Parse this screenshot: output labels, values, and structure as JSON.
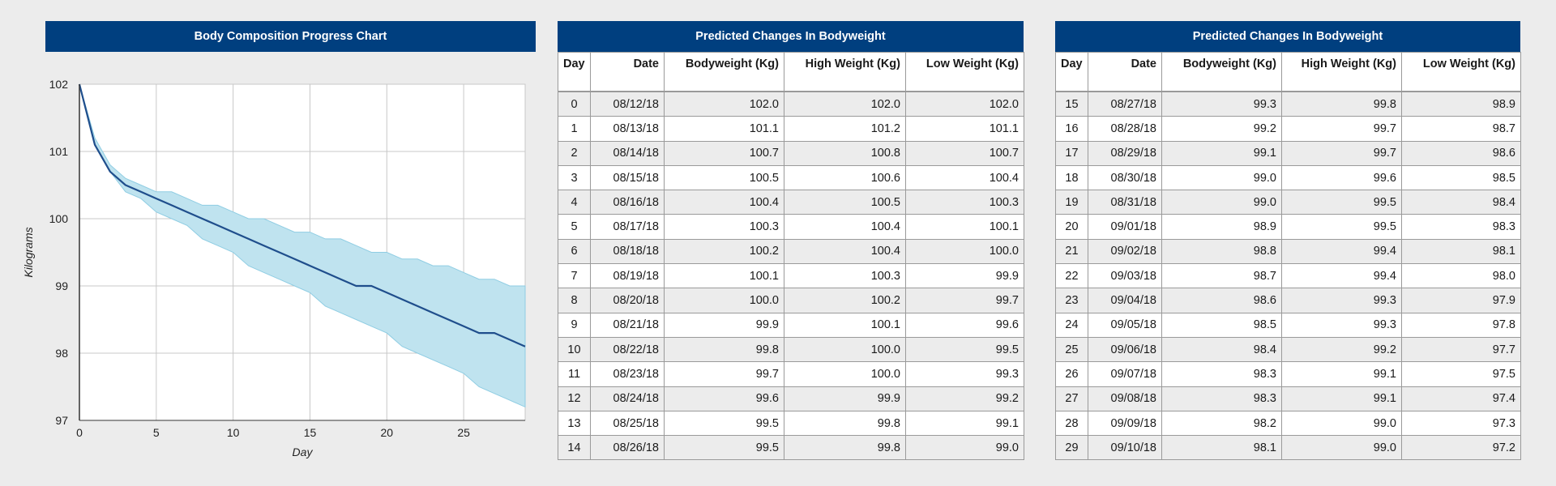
{
  "chart_panel": {
    "title": "Body Composition Progress Chart"
  },
  "table_panels": [
    {
      "title": "Predicted Changes In Bodyweight"
    },
    {
      "title": "Predicted Changes In Bodyweight"
    }
  ],
  "table_headers": [
    "Day",
    "Date",
    "Bodyweight (Kg)",
    "High Weight (Kg)",
    "Low Weight (Kg)"
  ],
  "rows": [
    {
      "day": "0",
      "date": "08/12/18",
      "bw": "102.0",
      "high": "102.0",
      "low": "102.0"
    },
    {
      "day": "1",
      "date": "08/13/18",
      "bw": "101.1",
      "high": "101.2",
      "low": "101.1"
    },
    {
      "day": "2",
      "date": "08/14/18",
      "bw": "100.7",
      "high": "100.8",
      "low": "100.7"
    },
    {
      "day": "3",
      "date": "08/15/18",
      "bw": "100.5",
      "high": "100.6",
      "low": "100.4"
    },
    {
      "day": "4",
      "date": "08/16/18",
      "bw": "100.4",
      "high": "100.5",
      "low": "100.3"
    },
    {
      "day": "5",
      "date": "08/17/18",
      "bw": "100.3",
      "high": "100.4",
      "low": "100.1"
    },
    {
      "day": "6",
      "date": "08/18/18",
      "bw": "100.2",
      "high": "100.4",
      "low": "100.0"
    },
    {
      "day": "7",
      "date": "08/19/18",
      "bw": "100.1",
      "high": "100.3",
      "low": "99.9"
    },
    {
      "day": "8",
      "date": "08/20/18",
      "bw": "100.0",
      "high": "100.2",
      "low": "99.7"
    },
    {
      "day": "9",
      "date": "08/21/18",
      "bw": "99.9",
      "high": "100.1",
      "low": "99.6"
    },
    {
      "day": "10",
      "date": "08/22/18",
      "bw": "99.8",
      "high": "100.0",
      "low": "99.5"
    },
    {
      "day": "11",
      "date": "08/23/18",
      "bw": "99.7",
      "high": "100.0",
      "low": "99.3"
    },
    {
      "day": "12",
      "date": "08/24/18",
      "bw": "99.6",
      "high": "99.9",
      "low": "99.2"
    },
    {
      "day": "13",
      "date": "08/25/18",
      "bw": "99.5",
      "high": "99.8",
      "low": "99.1"
    },
    {
      "day": "14",
      "date": "08/26/18",
      "bw": "99.5",
      "high": "99.8",
      "low": "99.0"
    },
    {
      "day": "15",
      "date": "08/27/18",
      "bw": "99.3",
      "high": "99.8",
      "low": "98.9"
    },
    {
      "day": "16",
      "date": "08/28/18",
      "bw": "99.2",
      "high": "99.7",
      "low": "98.7"
    },
    {
      "day": "17",
      "date": "08/29/18",
      "bw": "99.1",
      "high": "99.7",
      "low": "98.6"
    },
    {
      "day": "18",
      "date": "08/30/18",
      "bw": "99.0",
      "high": "99.6",
      "low": "98.5"
    },
    {
      "day": "19",
      "date": "08/31/18",
      "bw": "99.0",
      "high": "99.5",
      "low": "98.4"
    },
    {
      "day": "20",
      "date": "09/01/18",
      "bw": "98.9",
      "high": "99.5",
      "low": "98.3"
    },
    {
      "day": "21",
      "date": "09/02/18",
      "bw": "98.8",
      "high": "99.4",
      "low": "98.1"
    },
    {
      "day": "22",
      "date": "09/03/18",
      "bw": "98.7",
      "high": "99.4",
      "low": "98.0"
    },
    {
      "day": "23",
      "date": "09/04/18",
      "bw": "98.6",
      "high": "99.3",
      "low": "97.9"
    },
    {
      "day": "24",
      "date": "09/05/18",
      "bw": "98.5",
      "high": "99.3",
      "low": "97.8"
    },
    {
      "day": "25",
      "date": "09/06/18",
      "bw": "98.4",
      "high": "99.2",
      "low": "97.7"
    },
    {
      "day": "26",
      "date": "09/07/18",
      "bw": "98.3",
      "high": "99.1",
      "low": "97.5"
    },
    {
      "day": "27",
      "date": "09/08/18",
      "bw": "98.3",
      "high": "99.1",
      "low": "97.4"
    },
    {
      "day": "28",
      "date": "09/09/18",
      "bw": "98.2",
      "high": "99.0",
      "low": "97.3"
    },
    {
      "day": "29",
      "date": "09/10/18",
      "bw": "98.1",
      "high": "99.0",
      "low": "97.2"
    }
  ],
  "chart_data": {
    "type": "area",
    "title": "Body Composition Progress Chart",
    "xlabel": "Day",
    "ylabel": "Kilograms",
    "xlim": [
      0,
      29
    ],
    "ylim": [
      97,
      102
    ],
    "xticks": [
      0,
      5,
      10,
      15,
      20,
      25
    ],
    "yticks": [
      97,
      98,
      99,
      100,
      101,
      102
    ],
    "grid": true,
    "x": [
      0,
      1,
      2,
      3,
      4,
      5,
      6,
      7,
      8,
      9,
      10,
      11,
      12,
      13,
      14,
      15,
      16,
      17,
      18,
      19,
      20,
      21,
      22,
      23,
      24,
      25,
      26,
      27,
      28,
      29
    ],
    "series": [
      {
        "values": [
          102.0,
          101.1,
          100.7,
          100.5,
          100.4,
          100.3,
          100.2,
          100.1,
          100.0,
          99.9,
          99.8,
          99.7,
          99.6,
          99.5,
          99.4,
          99.3,
          99.2,
          99.1,
          99.0,
          99.0,
          98.9,
          98.8,
          98.7,
          98.6,
          98.5,
          98.4,
          98.3,
          98.3,
          98.2,
          98.1
        ]
      },
      {
        "values": [
          102.0,
          101.2,
          100.8,
          100.6,
          100.5,
          100.4,
          100.4,
          100.3,
          100.2,
          100.2,
          100.1,
          100.0,
          100.0,
          99.9,
          99.8,
          99.8,
          99.7,
          99.7,
          99.6,
          99.5,
          99.5,
          99.4,
          99.4,
          99.3,
          99.3,
          99.2,
          99.1,
          99.1,
          99.0,
          99.0
        ]
      },
      {
        "values": [
          102.0,
          101.1,
          100.7,
          100.4,
          100.3,
          100.1,
          100.0,
          99.9,
          99.7,
          99.6,
          99.5,
          99.3,
          99.2,
          99.1,
          99.0,
          98.9,
          98.7,
          98.6,
          98.5,
          98.4,
          98.3,
          98.1,
          98.0,
          97.9,
          97.8,
          97.7,
          97.5,
          97.4,
          97.3,
          97.2
        ]
      }
    ],
    "colors": {
      "line": "#1f4e8c",
      "band": "#bfe3ef",
      "band_edge": "#8fcde3",
      "grid": "#c8c8c8",
      "axis": "#333333"
    }
  }
}
